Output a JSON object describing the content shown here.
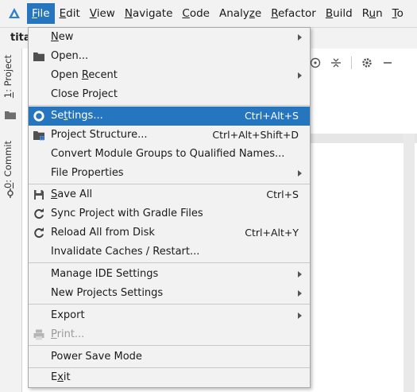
{
  "menubar": {
    "items": [
      {
        "mnemonic": "F",
        "rest": "ile"
      },
      {
        "mnemonic": "E",
        "rest": "dit"
      },
      {
        "mnemonic": "V",
        "rest": "iew"
      },
      {
        "mnemonic": "N",
        "rest": "avigate"
      },
      {
        "mnemonic": "C",
        "rest": "ode"
      },
      {
        "prefix": "Analy",
        "mnemonic": "z",
        "rest": "e"
      },
      {
        "mnemonic": "R",
        "rest": "efactor"
      },
      {
        "mnemonic": "B",
        "rest": "uild"
      },
      {
        "prefix": "R",
        "mnemonic": "u",
        "rest": "n"
      },
      {
        "mnemonic": "T",
        "rest": "o"
      }
    ]
  },
  "project": {
    "title": "tita"
  },
  "left_strip": {
    "project_tab": {
      "mnemonic": "1",
      "rest": ": Project"
    },
    "commit_tab": {
      "mnemonic": "0",
      "rest": ": Commit"
    }
  },
  "file_menu": {
    "new": {
      "mnemonic": "N",
      "rest": "ew"
    },
    "open": {
      "label": "Open..."
    },
    "open_recent": {
      "prefix": "Open ",
      "mnemonic": "R",
      "rest": "ecent"
    },
    "close_project": {
      "label": "Close Project"
    },
    "settings": {
      "prefix": "Se",
      "mnemonic": "t",
      "rest": "tings...",
      "shortcut": "Ctrl+Alt+S"
    },
    "project_structure": {
      "label": "Project Structure...",
      "shortcut": "Ctrl+Alt+Shift+D"
    },
    "convert_module_groups": {
      "label": "Convert Module Groups to Qualified Names..."
    },
    "file_properties": {
      "label": "File Properties"
    },
    "save_all": {
      "mnemonic": "S",
      "rest": "ave All",
      "shortcut": "Ctrl+S"
    },
    "sync_gradle": {
      "label": "Sync Project with Gradle Files"
    },
    "reload_all": {
      "label": "Reload All from Disk",
      "shortcut": "Ctrl+Alt+Y"
    },
    "invalidate_caches": {
      "label": "Invalidate Caches / Restart..."
    },
    "manage_ide_settings": {
      "label": "Manage IDE Settings"
    },
    "new_projects_settings": {
      "label": "New Projects Settings"
    },
    "export": {
      "label": "Export"
    },
    "print": {
      "mnemonic": "P",
      "rest": "rint..."
    },
    "power_save_mode": {
      "label": "Power Save Mode"
    },
    "exit": {
      "prefix": "E",
      "mnemonic": "x",
      "rest": "it"
    }
  },
  "icons": {
    "app_logo": "android-studio-logo-icon",
    "open": "folder-icon",
    "settings": "gear-icon",
    "project_structure": "project-structure-icon",
    "save_all": "save-icon",
    "sync": "sync-icon",
    "reload": "reload-icon",
    "print": "printer-icon"
  },
  "colors": {
    "selection": "#2675bf",
    "menu_bg": "#f2f2f2"
  }
}
